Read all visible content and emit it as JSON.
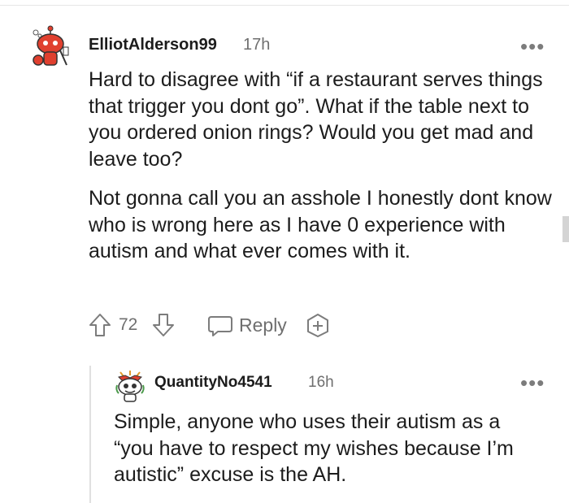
{
  "comments": [
    {
      "username": "ElliotAlderson99",
      "time": "17h",
      "more_icon": "more-horizontal-icon",
      "paragraphs": [
        "Hard to disagree with “if a restaurant serves things that trigger you dont go”. What if the table next to you ordered onion rings? Would you get mad and leave too?",
        "Not gonna call you an asshole I honestly dont know who is wrong here as I have 0 experience with autism and what ever comes with it."
      ],
      "actions": {
        "vote_count": "72",
        "reply_label": "Reply",
        "upvote_icon": "upvote-arrow-icon",
        "downvote_icon": "downvote-arrow-icon",
        "reply_icon": "speech-bubble-icon",
        "award_icon": "award-plus-icon"
      }
    },
    {
      "username": "QuantityNo4541",
      "time": "16h",
      "more_icon": "more-horizontal-icon",
      "paragraphs": [
        "Simple, anyone who uses their autism as a “you have to respect my wishes because I’m autistic” excuse is the AH."
      ]
    }
  ],
  "colors": {
    "text": "#1c1c1c",
    "meta": "#6f6f6f",
    "avatar1": "#e0402f",
    "thread_line": "#e0e0e0"
  }
}
